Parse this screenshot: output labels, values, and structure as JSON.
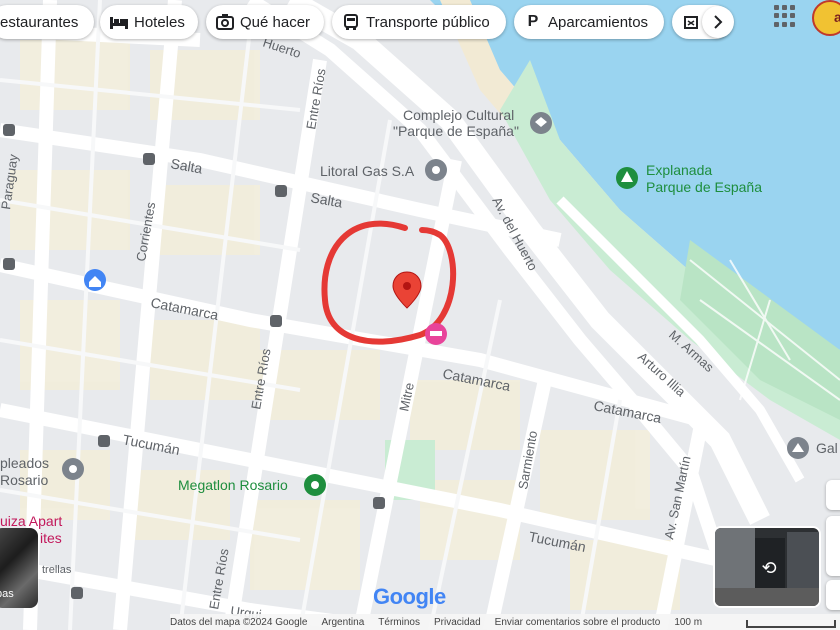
{
  "top_chips": [
    {
      "label": "estaurantes",
      "icon": "restaurant-icon"
    },
    {
      "label": "Hoteles",
      "icon": "bed-icon"
    },
    {
      "label": "Qué hacer",
      "icon": "camera-icon"
    },
    {
      "label": "Transporte público",
      "icon": "bus-icon"
    },
    {
      "label": "Aparcamientos",
      "icon": "parking-icon"
    }
  ],
  "streets": {
    "av_del_huerto": "Av. del Huerto",
    "huerto_top": "Huerto",
    "salta": "Salta",
    "catamarca": "Catamarca",
    "tucuman": "Tucumán",
    "entre_rios": "Entre Ríos",
    "corrientes": "Corrientes",
    "paraguay": "Paraguay",
    "mitre": "Mitre",
    "sarmiento": "Sarmiento",
    "san_martin": "Av. San Martín",
    "m_armas": "M. Armas",
    "arturo_illia": "Arturo Illia",
    "urquiza": "Urqui"
  },
  "pois": {
    "complejo_line1": "Complejo Cultural",
    "complejo_line2": "\"Parque de España\"",
    "litoral_gas": "Litoral Gas S.A",
    "explanada_line1": "Explanada",
    "explanada_line2": "Parque de España",
    "megatlon": "Megatlon Rosario",
    "empleados_line1": "pleados",
    "empleados_line2": "Rosario",
    "urquiza_line1": "uiza Apart",
    "urquiza_line2": "ites",
    "estrellas": "trellas",
    "gal": "Gal"
  },
  "thumb_label": "pas",
  "google_logo": "Google",
  "footer": {
    "map_data": "Datos del mapa ©2024 Google",
    "country": "Argentina",
    "terms": "Términos",
    "privacy": "Privacidad",
    "feedback": "Enviar comentarios sobre el producto",
    "scale": "100 m"
  },
  "avatar_text": "as",
  "colors": {
    "water": "#9ad4f0",
    "park": "#c9ecd3",
    "road": "#ffffff",
    "block": "#e8eaed",
    "pin": "#ea4335",
    "circle": "#e53935",
    "poi_gray": "#7c838c",
    "poi_green": "#1e8e3e"
  }
}
